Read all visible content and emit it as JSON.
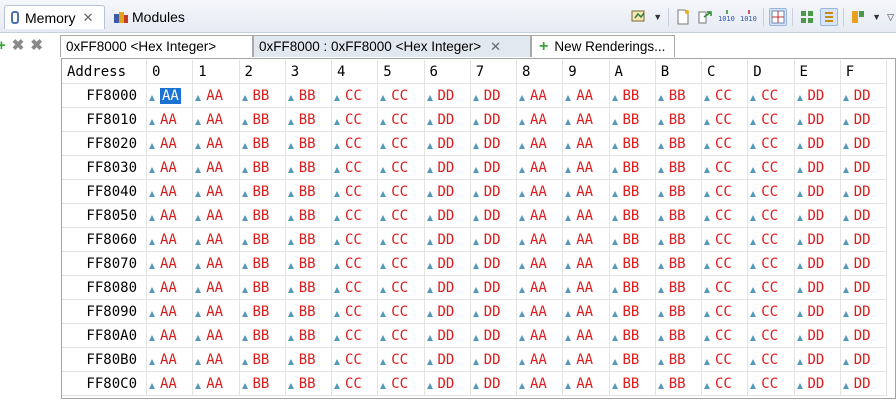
{
  "views": {
    "memory_label": "Memory",
    "modules_label": "Modules"
  },
  "renderings": {
    "tab1": "0xFF8000 <Hex Integer>",
    "tab2": "0xFF8000 : 0xFF8000 <Hex Integer>",
    "tab3": "New Renderings..."
  },
  "table": {
    "address_header": "Address",
    "columns": [
      "0",
      "1",
      "2",
      "3",
      "4",
      "5",
      "6",
      "7",
      "8",
      "9",
      "A",
      "B",
      "C",
      "D",
      "E",
      "F"
    ],
    "row_addresses": [
      "FF8000",
      "FF8010",
      "FF8020",
      "FF8030",
      "FF8040",
      "FF8050",
      "FF8060",
      "FF8070",
      "FF8080",
      "FF8090",
      "FF80A0",
      "FF80B0",
      "FF80C0"
    ],
    "row_values": [
      "AA",
      "AA",
      "BB",
      "BB",
      "CC",
      "CC",
      "DD",
      "DD",
      "AA",
      "AA",
      "BB",
      "BB",
      "CC",
      "CC",
      "DD",
      "DD"
    ],
    "selected_cell": "FF8000:0"
  },
  "colors": {
    "value_text": "#dd1c1c",
    "selection": "#1a73d0"
  }
}
